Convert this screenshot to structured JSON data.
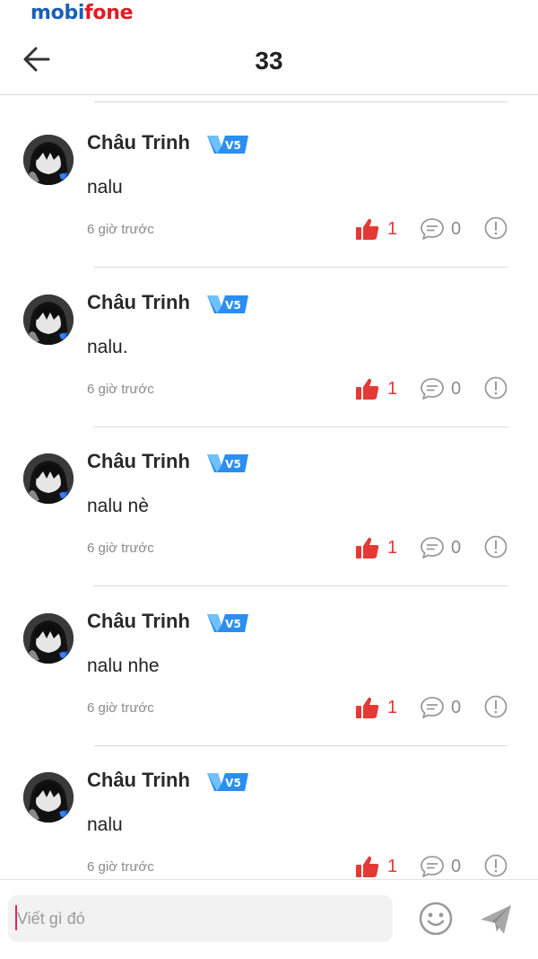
{
  "status_bar": {
    "carrier_part1": "mobi",
    "carrier_part2": "fone"
  },
  "header": {
    "title": "33",
    "back_icon": "arrow-left-icon"
  },
  "comments": [
    {
      "author": "Châu Trinh",
      "badge": "V5",
      "text": "nalu",
      "time": "6 giờ trước",
      "likes": "1",
      "replies": "0"
    },
    {
      "author": "Châu Trinh",
      "badge": "V5",
      "text": "nalu.",
      "time": "6 giờ trước",
      "likes": "1",
      "replies": "0"
    },
    {
      "author": "Châu Trinh",
      "badge": "V5",
      "text": "nalu nè",
      "time": "6 giờ trước",
      "likes": "1",
      "replies": "0"
    },
    {
      "author": "Châu Trinh",
      "badge": "V5",
      "text": "nalu nhe",
      "time": "6 giờ trước",
      "likes": "1",
      "replies": "0"
    },
    {
      "author": "Châu Trinh",
      "badge": "V5",
      "text": "nalu",
      "time": "6 giờ trước",
      "likes": "1",
      "replies": "0"
    }
  ],
  "composer": {
    "placeholder": "Viết gì đó",
    "emoji_icon": "smiley-icon",
    "send_icon": "paper-plane-icon"
  },
  "colors": {
    "like": "#e53935",
    "badge": "#2196f3",
    "carrier_blue": "#1a5fb4",
    "carrier_red": "#e01b24"
  }
}
